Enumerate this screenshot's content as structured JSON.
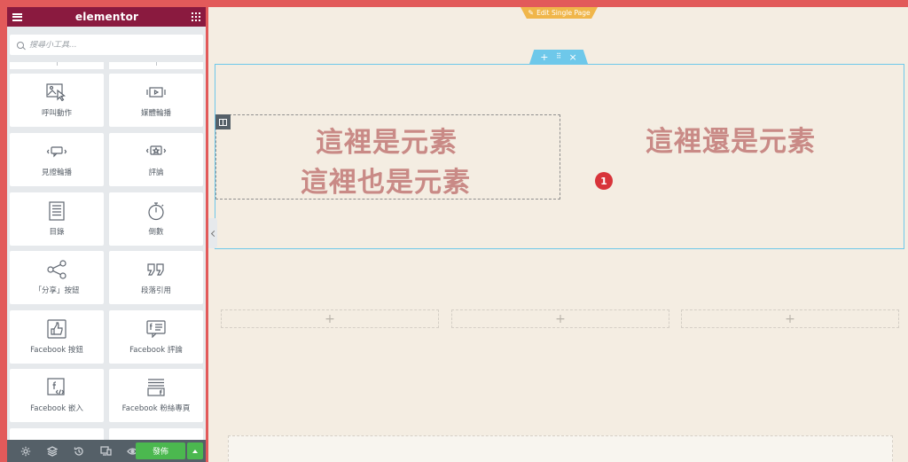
{
  "panel": {
    "logo": "elementor",
    "search": {
      "placeholder": "搜尋小工具..."
    },
    "widgets": [
      {
        "label": "呼叫動作",
        "icon": "call-to-action-icon"
      },
      {
        "label": "媒體輪播",
        "icon": "media-carousel-icon"
      },
      {
        "label": "見證輪播",
        "icon": "testimonial-carousel-icon"
      },
      {
        "label": "評論",
        "icon": "reviews-icon"
      },
      {
        "label": "目錄",
        "icon": "table-of-contents-icon"
      },
      {
        "label": "倒數",
        "icon": "countdown-icon"
      },
      {
        "label": "「分享」按鈕",
        "icon": "share-icon"
      },
      {
        "label": "段落引用",
        "icon": "blockquote-icon"
      },
      {
        "label": "Facebook 按鈕",
        "icon": "facebook-like-icon"
      },
      {
        "label": "Facebook 評論",
        "icon": "facebook-comments-icon"
      },
      {
        "label": "Facebook 嵌入",
        "icon": "facebook-embed-icon"
      },
      {
        "label": "Facebook 粉絲專頁",
        "icon": "facebook-page-icon"
      }
    ],
    "footer": {
      "publish_label": "發佈",
      "icons": [
        "settings-icon",
        "navigator-icon",
        "history-icon",
        "responsive-icon",
        "preview-icon"
      ]
    }
  },
  "canvas": {
    "edit_tab_label": "Edit Single Page",
    "section_handle": {
      "add": "+",
      "move": "⠿",
      "close": "×"
    },
    "text1": "這裡是元素",
    "text2": "這裡也是元素",
    "text3": "這裡還是元素",
    "badge": "1",
    "add_plus": "+"
  },
  "colors": {
    "header": "#8a1a3f",
    "publish": "#4bb84f",
    "canvas_bg": "#f4ede2",
    "section_border": "#6ec8ea",
    "text": "#c98a86",
    "badge": "#d8343a",
    "frame_border": "#e25a5a"
  }
}
